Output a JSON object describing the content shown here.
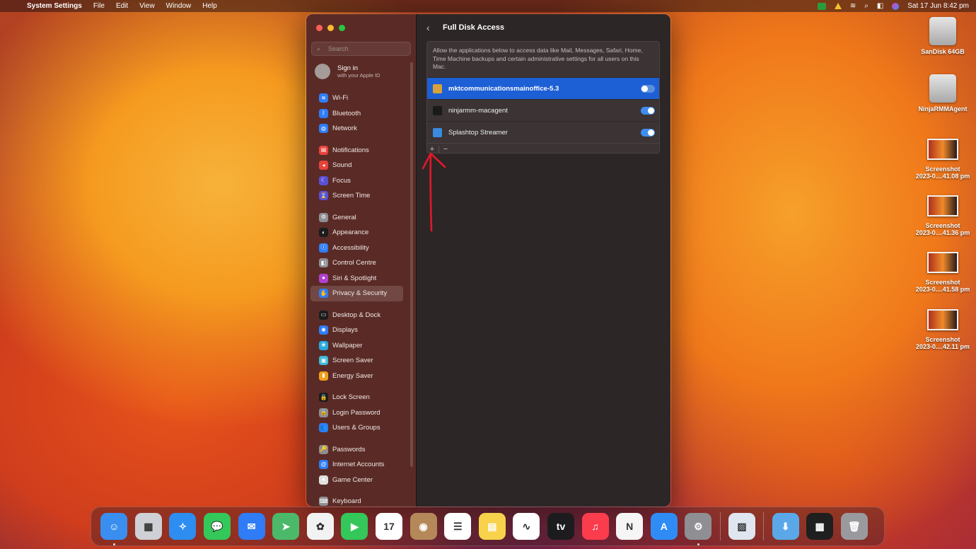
{
  "menubar": {
    "app_name": "System Settings",
    "menus": [
      "File",
      "Edit",
      "View",
      "Window",
      "Help"
    ],
    "clock": "Sat 17 Jun  8:42 pm"
  },
  "desktop": {
    "drives": [
      "SanDisk 64GB",
      "NinjaRMMAgent"
    ],
    "screenshots": [
      {
        "line1": "Screenshot",
        "line2": "2023-0....41.08 pm"
      },
      {
        "line1": "Screenshot",
        "line2": "2023-0....41.36 pm"
      },
      {
        "line1": "Screenshot",
        "line2": "2023-0....41.58 pm"
      },
      {
        "line1": "Screenshot",
        "line2": "2023-0....42.11 pm"
      }
    ]
  },
  "sidebar": {
    "search_placeholder": "Search",
    "signin_title": "Sign in",
    "signin_subtitle": "with your Apple ID",
    "items": [
      {
        "label": "Wi-Fi",
        "color": "#2f7cf6",
        "glyph": "≋"
      },
      {
        "label": "Bluetooth",
        "color": "#2f7cf6",
        "glyph": "ᛒ"
      },
      {
        "label": "Network",
        "color": "#2f7cf6",
        "glyph": "◍"
      },
      {
        "label": "Notifications",
        "color": "#e8423a",
        "glyph": "▤"
      },
      {
        "label": "Sound",
        "color": "#e8423a",
        "glyph": "◂"
      },
      {
        "label": "Focus",
        "color": "#5b4fd6",
        "glyph": "☾"
      },
      {
        "label": "Screen Time",
        "color": "#5b4fd6",
        "glyph": "⌛"
      },
      {
        "label": "General",
        "color": "#8e8e93",
        "glyph": "⚙"
      },
      {
        "label": "Appearance",
        "color": "#1c1c1e",
        "glyph": "◐"
      },
      {
        "label": "Accessibility",
        "color": "#2f7cf6",
        "glyph": "ⓘ"
      },
      {
        "label": "Control Centre",
        "color": "#8e8e93",
        "glyph": "◧"
      },
      {
        "label": "Siri & Spotlight",
        "color": "#b23fd0",
        "glyph": "●"
      },
      {
        "label": "Privacy & Security",
        "color": "#2f7cf6",
        "glyph": "✋"
      },
      {
        "label": "Desktop & Dock",
        "color": "#1c1c1e",
        "glyph": "▭"
      },
      {
        "label": "Displays",
        "color": "#2f7cf6",
        "glyph": "✺"
      },
      {
        "label": "Wallpaper",
        "color": "#2aa8e0",
        "glyph": "❀"
      },
      {
        "label": "Screen Saver",
        "color": "#3fb8d8",
        "glyph": "▣"
      },
      {
        "label": "Energy Saver",
        "color": "#f0a01c",
        "glyph": "▮"
      },
      {
        "label": "Lock Screen",
        "color": "#1c1c1e",
        "glyph": "🔒"
      },
      {
        "label": "Login Password",
        "color": "#8e8e93",
        "glyph": "🔒"
      },
      {
        "label": "Users & Groups",
        "color": "#2f7cf6",
        "glyph": "👥"
      },
      {
        "label": "Passwords",
        "color": "#8e8e93",
        "glyph": "🔑"
      },
      {
        "label": "Internet Accounts",
        "color": "#2f7cf6",
        "glyph": "@"
      },
      {
        "label": "Game Center",
        "color": "#e0e0e0",
        "glyph": "●"
      },
      {
        "label": "Keyboard",
        "color": "#8e8e93",
        "glyph": "⌨"
      }
    ],
    "selected_index": 12
  },
  "content": {
    "title": "Full Disk Access",
    "description": "Allow the applications below to access data like Mail, Messages, Safari, Home, Time Machine backups and certain administrative settings for all users on this Mac.",
    "apps": [
      {
        "name": "mktcommunicationsmainoffice-5.3",
        "enabled": false,
        "selected": true,
        "icon_color": "#d8a23a"
      },
      {
        "name": "ninjarmm-macagent",
        "enabled": true,
        "selected": false,
        "icon_color": "#1a1a1a"
      },
      {
        "name": "Splashtop Streamer",
        "enabled": true,
        "selected": false,
        "icon_color": "#3a8ae0"
      }
    ],
    "add_label": "+",
    "remove_label": "−"
  },
  "dock": {
    "apps": [
      {
        "name": "Finder",
        "color": "#3a8ef0",
        "glyph": "☺",
        "running": true
      },
      {
        "name": "Launchpad",
        "color": "#cfcfd6",
        "glyph": "▦",
        "running": false
      },
      {
        "name": "Safari",
        "color": "#2e8df0",
        "glyph": "✧",
        "running": false
      },
      {
        "name": "Messages",
        "color": "#34c759",
        "glyph": "💬",
        "running": false
      },
      {
        "name": "Mail",
        "color": "#2f7cf6",
        "glyph": "✉",
        "running": false
      },
      {
        "name": "Maps",
        "color": "#4cb96a",
        "glyph": "➤",
        "running": false
      },
      {
        "name": "Photos",
        "color": "#f2f2f2",
        "glyph": "✿",
        "running": false
      },
      {
        "name": "FaceTime",
        "color": "#34c759",
        "glyph": "▶",
        "running": false
      },
      {
        "name": "Calendar",
        "color": "#ffffff",
        "glyph": "17",
        "running": false
      },
      {
        "name": "Contacts",
        "color": "#b5885a",
        "glyph": "◉",
        "running": false
      },
      {
        "name": "Reminders",
        "color": "#ffffff",
        "glyph": "☰",
        "running": false
      },
      {
        "name": "Notes",
        "color": "#f7d24a",
        "glyph": "▤",
        "running": false
      },
      {
        "name": "Freeform",
        "color": "#ffffff",
        "glyph": "∿",
        "running": false
      },
      {
        "name": "TV",
        "color": "#1c1c1e",
        "glyph": "tv",
        "running": false
      },
      {
        "name": "Music",
        "color": "#fa3c4c",
        "glyph": "♫",
        "running": false
      },
      {
        "name": "News",
        "color": "#f5f5f5",
        "glyph": "N",
        "running": false
      },
      {
        "name": "App Store",
        "color": "#2f8cf5",
        "glyph": "A",
        "running": false
      },
      {
        "name": "System Settings",
        "color": "#8e8e93",
        "glyph": "⚙",
        "running": true
      }
    ],
    "extra": [
      {
        "name": "Preview",
        "color": "#dfe6ef",
        "glyph": "▨"
      }
    ],
    "stacks": [
      {
        "name": "Downloads",
        "color": "#5aa8e8",
        "glyph": "⬇"
      },
      {
        "name": "Screenshot stack",
        "color": "#1f1f1f",
        "glyph": "▦"
      },
      {
        "name": "Trash",
        "color": "#9a9a9e",
        "glyph": "🗑"
      }
    ]
  },
  "annotation_color": "#e0182a"
}
